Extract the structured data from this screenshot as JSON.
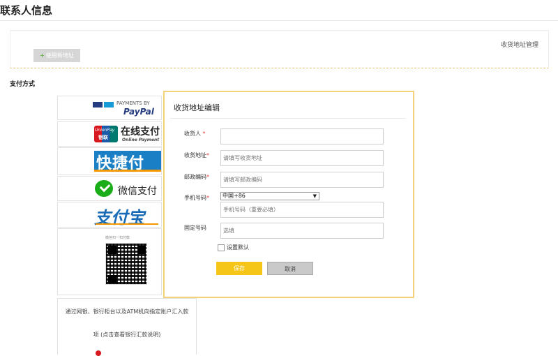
{
  "page": {
    "title": "联系人信息",
    "address_manage_link": "收货地址管理",
    "new_address_label": "使用新地址"
  },
  "payment": {
    "section_label": "支付方式",
    "paypal": {
      "line1": "PAYMENTS BY",
      "line2": "PayPal"
    },
    "unionpay": {
      "logo_top": "UnionPay",
      "logo_bottom": "银联",
      "title": "在线支付",
      "subtitle": "Online Payment"
    },
    "kuaijie": {
      "label": "快捷付"
    },
    "wechat": {
      "label": "微信支付"
    },
    "alipay": {
      "label": "支付宝"
    },
    "qr": {
      "caption": "微信扫一扫付款"
    },
    "bank_transfer": {
      "line1": "通过网银、银行柜台以及ATM机向指定账户汇入款",
      "line2": "项 (点击查看银行汇款说明)"
    }
  },
  "modal": {
    "title": "收货地址编辑",
    "fields": {
      "recipient": {
        "label": "收货人",
        "value": ""
      },
      "address": {
        "label": "收货地址",
        "placeholder": "请填写收货地址"
      },
      "postcode": {
        "label": "邮政编码",
        "placeholder": "请填写邮政编码"
      },
      "mobile": {
        "label": "手机号码",
        "country": "中国+86",
        "placeholder": "手机号码（重要必填）"
      },
      "landline": {
        "label": "固定号码",
        "placeholder": "选填"
      }
    },
    "required_mark": "*",
    "default_checkbox_label": "设置默认",
    "save_label": "保存",
    "cancel_label": "取消"
  },
  "colors": {
    "accent_yellow": "#f5c518",
    "modal_border": "#f3d27a",
    "required_red": "#e0413a",
    "paypal_blue": "#253b80",
    "paypal_light": "#179bd7",
    "unionpay_red": "#d7181e",
    "kuaijie_blue": "#1a7fc4",
    "kuaijie_orange": "#f39800",
    "wechat_green": "#1aad19",
    "alipay_blue": "#1a6bb6"
  }
}
